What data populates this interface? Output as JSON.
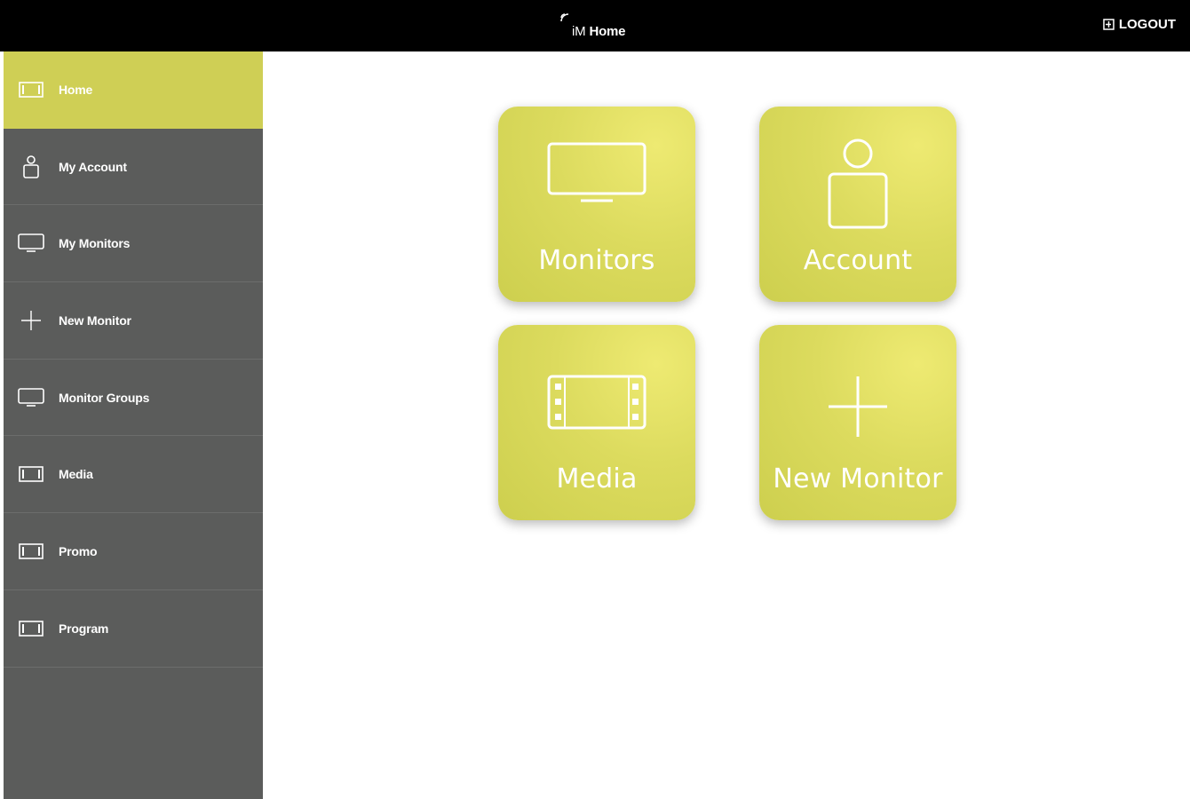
{
  "header": {
    "brand": "iM",
    "title": "Home",
    "logout_label": "LOGOUT"
  },
  "sidebar": {
    "items": [
      {
        "label": "Home",
        "icon": "media-strip-icon",
        "active": true
      },
      {
        "label": "My Account",
        "icon": "user-icon"
      },
      {
        "label": "My Monitors",
        "icon": "monitor-icon"
      },
      {
        "label": "New Monitor",
        "icon": "plus-icon"
      },
      {
        "label": "Monitor Groups",
        "icon": "monitor-icon"
      },
      {
        "label": "Media",
        "icon": "media-strip-icon"
      },
      {
        "label": "Promo",
        "icon": "media-strip-icon"
      },
      {
        "label": "Program",
        "icon": "media-strip-icon"
      }
    ]
  },
  "tiles": [
    {
      "label": "Monitors",
      "icon": "monitor-icon"
    },
    {
      "label": "Account",
      "icon": "user-icon"
    },
    {
      "label": "Media",
      "icon": "film-icon"
    },
    {
      "label": "New Monitor",
      "icon": "plus-icon"
    }
  ],
  "colors": {
    "accent": "#cfcf55",
    "sidebar": "#5b5c5b",
    "topbar": "#000000"
  }
}
